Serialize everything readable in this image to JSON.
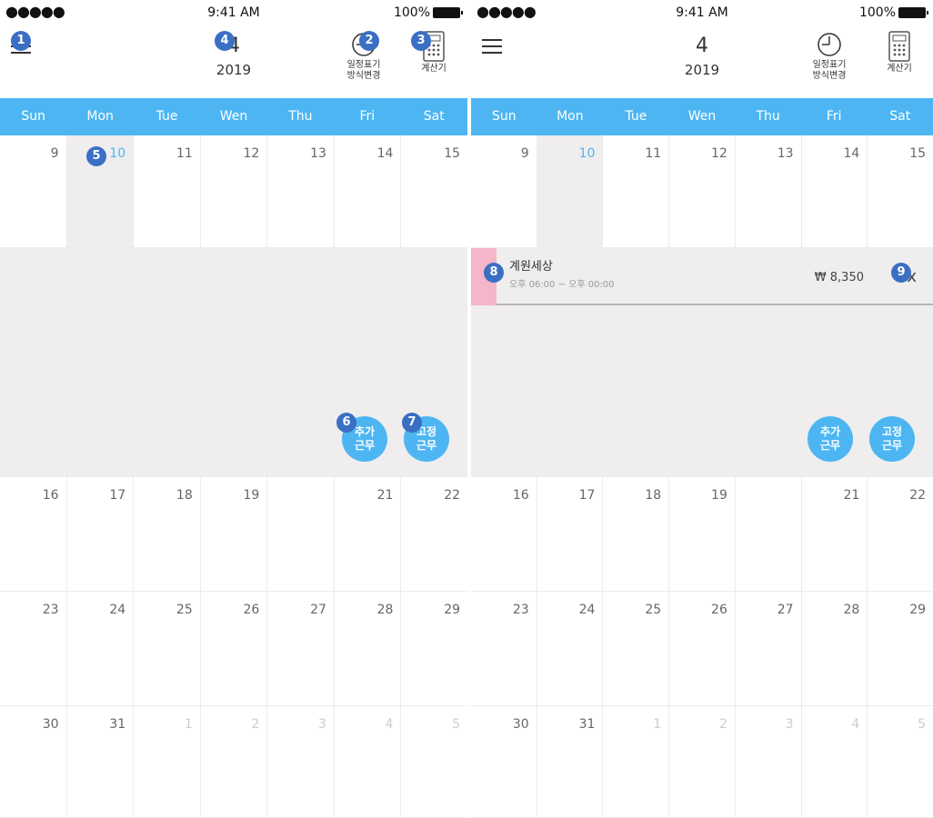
{
  "status_bar": {
    "signal": "●●●●●",
    "time": "9:41 AM",
    "battery": "100%"
  },
  "header": {
    "month": "4",
    "year": "2019",
    "view_toggle_label": "일정표기\n방식변경",
    "calculator_label": "계산기"
  },
  "weekdays": [
    "Sun",
    "Mon",
    "Tue",
    "Wen",
    "Thu",
    "Fri",
    "Sat"
  ],
  "weeks": [
    [
      "9",
      "10",
      "11",
      "12",
      "13",
      "14",
      "15"
    ],
    [
      "16",
      "17",
      "18",
      "19",
      "",
      "21",
      "22"
    ],
    [
      "23",
      "24",
      "25",
      "26",
      "27",
      "28",
      "29"
    ],
    [
      "30",
      "31",
      "1",
      "2",
      "3",
      "4",
      "5"
    ]
  ],
  "buttons": {
    "add_shift": "추가\n근무",
    "fixed_shift": "고정\n근무"
  },
  "shift": {
    "name": "계원세상",
    "time": "오후 06:00 ~ 오후 00:00",
    "pay": "₩ 8,350",
    "delete": "x",
    "color": "#f5b6c9"
  },
  "markers": [
    "1",
    "2",
    "3",
    "4",
    "5",
    "6",
    "7",
    "8",
    "9"
  ],
  "colors": {
    "accent": "#4db6f2",
    "selected_bg": "#efedee",
    "marker": "#3a6fc4"
  }
}
